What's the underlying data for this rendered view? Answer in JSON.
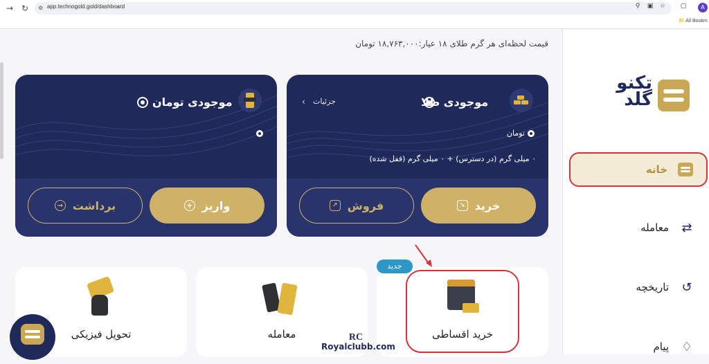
{
  "browser": {
    "url": "app.technogold.gold/dashboard",
    "bookmarks_label": "All Bookm",
    "avatar_letter": "A"
  },
  "sidebar": {
    "logo_text": "تکنو گلد",
    "items": [
      {
        "label": "خانه",
        "icon": "home-icon",
        "active": true
      },
      {
        "label": "معامله",
        "icon": "trade-icon"
      },
      {
        "label": "تاریخچه",
        "icon": "history-icon"
      },
      {
        "label": "پیام",
        "icon": "bell-icon"
      }
    ]
  },
  "ticker": {
    "text": "قیمت لحظه‌ای هر گرم طلای ۱۸ عیار:۱۸,۷۶۳,۰۰۰ تومان"
  },
  "gold_card": {
    "title": "موجودی طلا",
    "details_label": "جزئیات",
    "unit_label": "تومان",
    "balance_line": "۰ میلی گرم (در دسترس) + ۰ میلی گرم (قفل شده)",
    "buy_label": "خرید",
    "sell_label": "فروش"
  },
  "toman_card": {
    "title": "موجودی تومان",
    "deposit_label": "واریز",
    "withdraw_label": "برداشت"
  },
  "tiles": [
    {
      "label": "خرید اقساطی",
      "badge": "جدید",
      "icon": "calendar-gold-icon"
    },
    {
      "label": "معامله",
      "icon": "bars-trade-icon"
    },
    {
      "label": "تحویل فیزیکی",
      "icon": "hand-gold-icon"
    }
  ],
  "watermark": {
    "logo": "RC",
    "text": "Royalclubb.com"
  },
  "colors": {
    "navy": "#1f2a5a",
    "gold": "#cfb168",
    "highlight_red": "#d3343a",
    "badge_blue": "#2d97c8"
  }
}
